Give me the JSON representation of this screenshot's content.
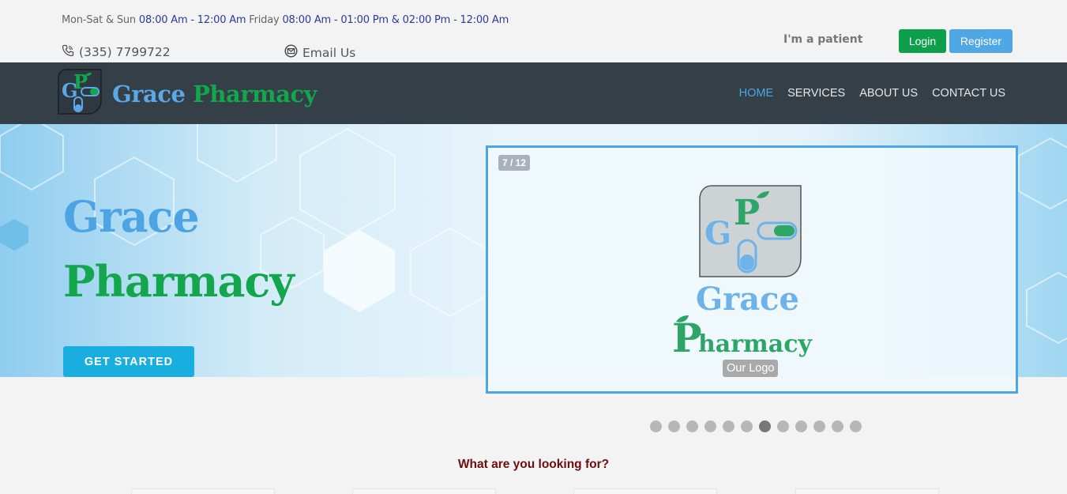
{
  "topbar": {
    "hours_days1": "Mon-Sat & Sun ",
    "hours_time1": "08:00 Am - 12:00 Am",
    "hours_days2": " Friday ",
    "hours_time2": "08:00 Am - 01:00 Pm & 02:00 Pm - 12:00 Am",
    "phone": "(335) 7799722",
    "email_label": "Email Us",
    "patient_label": "I'm a patient",
    "login_label": "Login",
    "register_label": "Register"
  },
  "brand": {
    "name_part1": "Grace",
    "name_part2": "Pharmacy"
  },
  "nav": {
    "items": [
      {
        "label": "HOME",
        "active": true
      },
      {
        "label": "SERVICES",
        "active": false
      },
      {
        "label": "ABOUT US",
        "active": false
      },
      {
        "label": "CONTACT US",
        "active": false
      }
    ]
  },
  "hero": {
    "title_line1": "Grace",
    "title_line2": "Pharmacy",
    "cta_label": "GET STARTED"
  },
  "slider": {
    "counter": "7 / 12",
    "caption": "Our Logo",
    "logo_word1": "Grace",
    "logo_word2": "harmacy",
    "total_slides": 12,
    "active_slide": 7
  },
  "section": {
    "looking_for": "What are you looking for?"
  },
  "colors": {
    "nav_bg": "#343f47",
    "brand_blue": "#4ca4e4",
    "brand_green": "#13a64c",
    "login_green": "#0e9f4c",
    "register_blue": "#4fa7e6"
  }
}
